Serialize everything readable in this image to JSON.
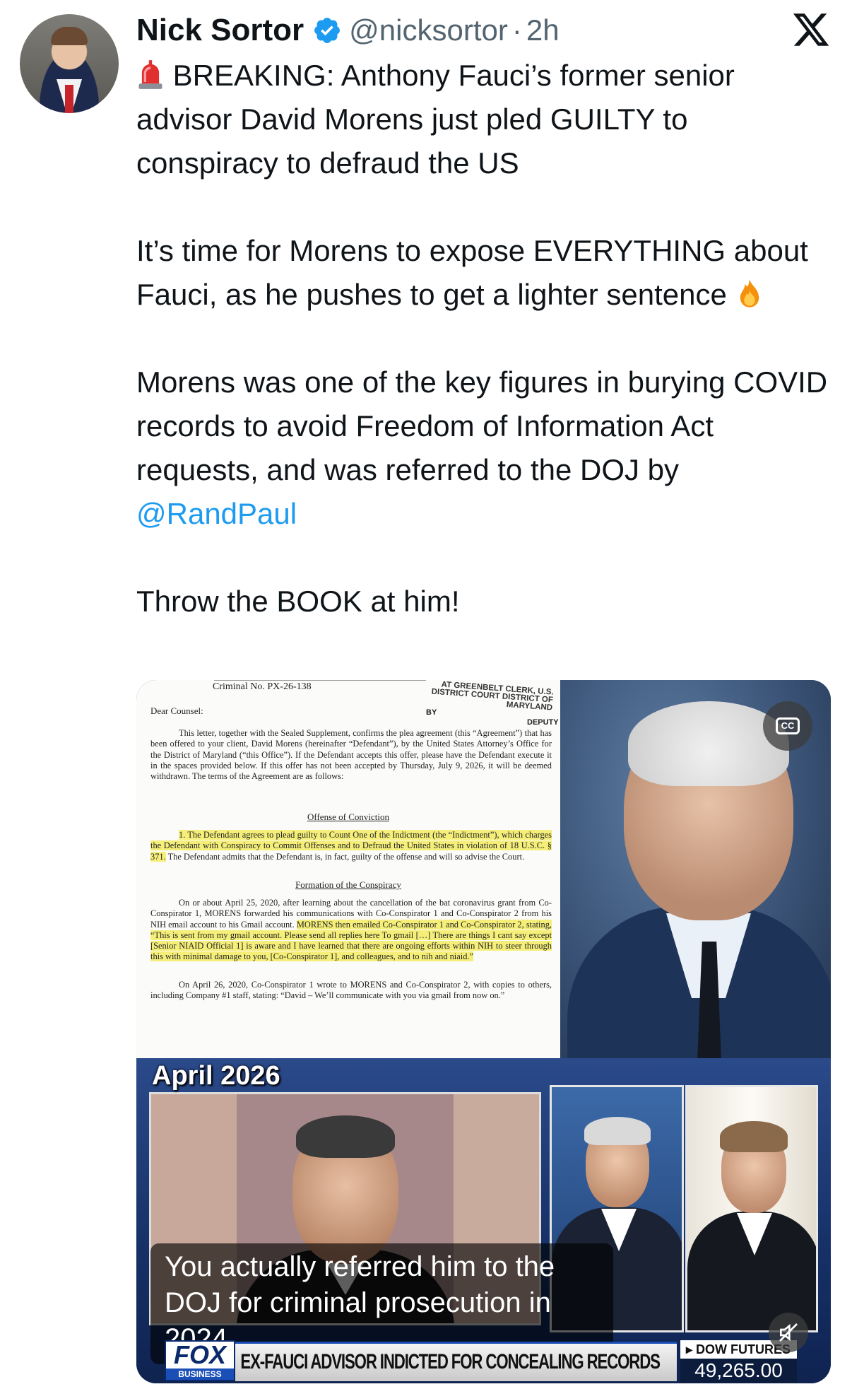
{
  "author": {
    "name": "Nick Sortor",
    "handle": "@nicksortor",
    "separator": "·",
    "time": "2h"
  },
  "tweet": {
    "paragraph1": "BREAKING: Anthony Fauci’s former senior advisor David Morens just pled GUILTY to conspiracy to defraud the US",
    "paragraph2": "It’s time for Morens to expose EVERYTHING about Fauci, as he pushes to get a lighter sentence",
    "paragraph3": "Morens was one of the key figures in burying COVID records to avoid Freedom of Information Act requests, and was referred to the DOJ by",
    "mention": "@RandPaul",
    "paragraph4": "Throw the BOOK at him!"
  },
  "icons": {
    "verified": "verified-badge-icon",
    "x_logo": "x-logo-icon",
    "siren": "siren-emoji",
    "fire": "fire-emoji",
    "captions": "closed-captions-icon",
    "mute": "volume-muted-icon"
  },
  "colors": {
    "mention": "#1d9bf0",
    "verified": "#1d9bf0",
    "handle": "#536471",
    "highlight": "#f5ef7a"
  },
  "document": {
    "case_number": "Criminal No. PX-26-138",
    "stamp": "AT GREENBELT CLERK, U.S. DISTRICT COURT DISTRICT OF MARYLAND",
    "stamp_by": "BY",
    "stamp_deputy": "DEPUTY",
    "salutation": "Dear Counsel:",
    "intro": "This letter, together with the Sealed Supplement, confirms the plea agreement (this “Agreement”) that has been offered to your client, David Morens (hereinafter “Defendant”), by the United States Attorney’s Office for the District of Maryland (“this Office”). If the Defendant accepts this offer, please have the Defendant execute it in the spaces provided below. If this offer has not been accepted by Thursday, July 9, 2026, it will be deemed withdrawn. The terms of the Agreement are as follows:",
    "heading1": "Offense of Conviction",
    "offense_highlight": "1. The Defendant agrees to plead guilty to Count One of the Indictment (the “Indictment”), which charges the Defendant with Conspiracy to Commit Offenses and to Defraud the United States in violation of 18 U.S.C. § 371.",
    "offense_rest": "The Defendant admits that the Defendant is, in fact, guilty of the offense and will so advise the Court.",
    "heading2": "Formation of the Conspiracy",
    "conspiracy_plain": "On or about April 25, 2020, after learning about the cancellation of the bat coronavirus grant from Co-Conspirator 1, MORENS forwarded his communications with Co-Conspirator 1 and Co-Conspirator 2 from his NIH email account to his Gmail account.",
    "conspiracy_highlight": "MORENS then emailed Co-Conspirator 1 and Co-Conspirator 2, stating, “This is sent from my gmail account. Please send all replies here To gmail […] There are things I cant say except [Senior NIAID Official 1] is aware and I have learned that there are ongoing efforts within NIH to steer through this with minimal damage to you, [Co-Conspirator 1], and colleagues, and to nih and niaid.”",
    "april26": "On April 26, 2020, Co-Conspirator 1 wrote to MORENS and Co-Conspirator 2, with copies to others, including Company #1 staff, stating: “David – We’ll communicate with you via gmail from now on.”"
  },
  "video": {
    "date_label": "April 2026",
    "caption": "You actually referred him to the DOJ for criminal prosecution in 2024.",
    "network": "FOX",
    "network_sub": "BUSINESS",
    "headline": "EX-FAUCI ADVISOR INDICTED FOR CONCEALING RECORDS",
    "ticker_label": "▸ DOW FUTURES",
    "ticker_value": "49,265.00",
    "cc_label": "CC"
  }
}
